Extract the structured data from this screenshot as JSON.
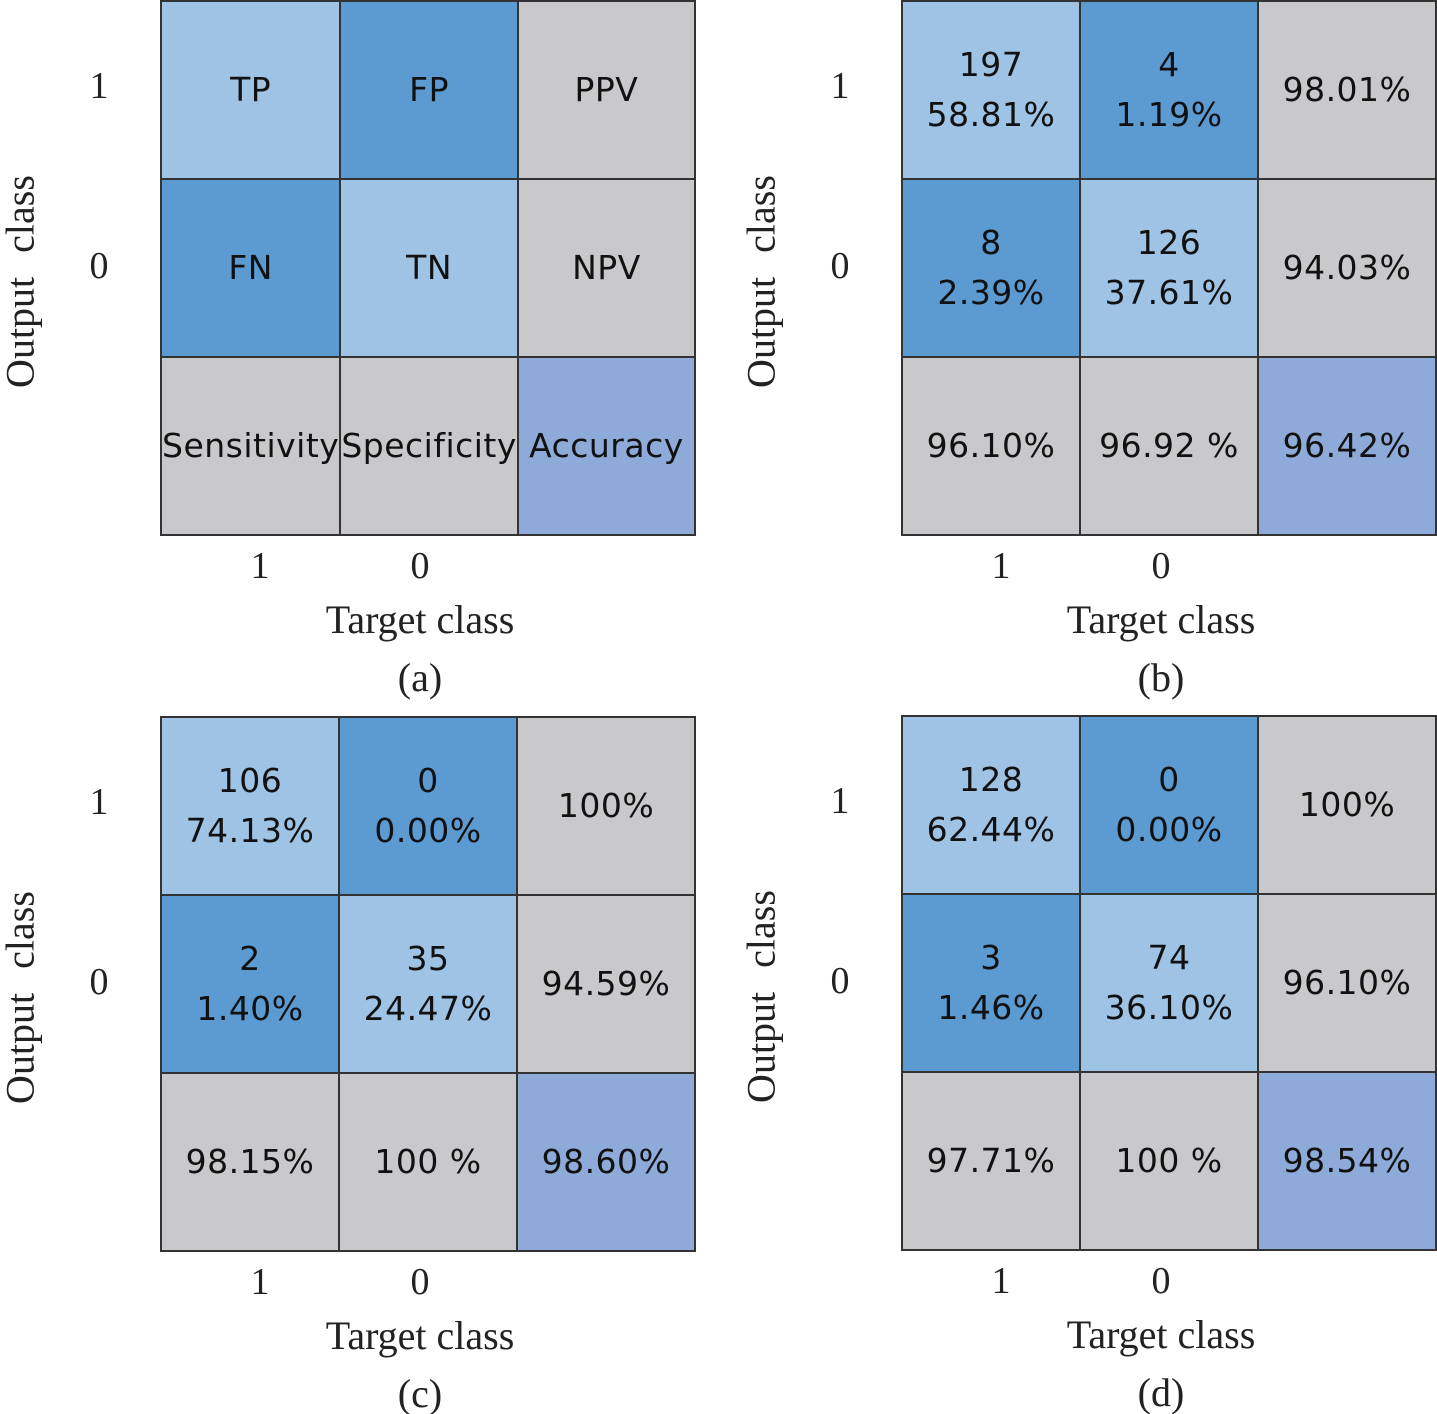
{
  "colors": {
    "correct": "#9fc3e5",
    "error": "#5b9bd2",
    "metric": "#c9c9cb",
    "accuracy": "#8eaad8"
  },
  "chart_data": [
    {
      "type": "heatmap",
      "panel": "(a)",
      "xlabel": "Target class",
      "ylabel": "Output class",
      "row_labels": [
        "1",
        "0"
      ],
      "col_labels": [
        "1",
        "0"
      ],
      "cells": [
        [
          [
            "TP"
          ],
          [
            "FP"
          ],
          [
            "PPV"
          ]
        ],
        [
          [
            "FN"
          ],
          [
            "TN"
          ],
          [
            "NPV"
          ]
        ],
        [
          [
            "Sensitivity"
          ],
          [
            "Specificity"
          ],
          [
            "Accuracy"
          ]
        ]
      ]
    },
    {
      "type": "heatmap",
      "panel": "(b)",
      "xlabel": "Target class",
      "ylabel": "Output class",
      "row_labels": [
        "1",
        "0"
      ],
      "col_labels": [
        "1",
        "0"
      ],
      "cells": [
        [
          [
            "197",
            "58.81%"
          ],
          [
            "4",
            "1.19%"
          ],
          [
            "98.01%"
          ]
        ],
        [
          [
            "8",
            "2.39%"
          ],
          [
            "126",
            "37.61%"
          ],
          [
            "94.03%"
          ]
        ],
        [
          [
            "96.10%"
          ],
          [
            "96.92 %"
          ],
          [
            "96.42%"
          ]
        ]
      ]
    },
    {
      "type": "heatmap",
      "panel": "(c)",
      "xlabel": "Target class",
      "ylabel": "Output class",
      "row_labels": [
        "1",
        "0"
      ],
      "col_labels": [
        "1",
        "0"
      ],
      "cells": [
        [
          [
            "106",
            "74.13%"
          ],
          [
            "0",
            "0.00%"
          ],
          [
            "100%"
          ]
        ],
        [
          [
            "2",
            "1.40%"
          ],
          [
            "35",
            "24.47%"
          ],
          [
            "94.59%"
          ]
        ],
        [
          [
            "98.15%"
          ],
          [
            "100 %"
          ],
          [
            "98.60%"
          ]
        ]
      ]
    },
    {
      "type": "heatmap",
      "panel": "(d)",
      "xlabel": "Target class",
      "ylabel": "Output class",
      "row_labels": [
        "1",
        "0"
      ],
      "col_labels": [
        "1",
        "0"
      ],
      "cells": [
        [
          [
            "128",
            "62.44%"
          ],
          [
            "0",
            "0.00%"
          ],
          [
            "100%"
          ]
        ],
        [
          [
            "3",
            "1.46%"
          ],
          [
            "74",
            "36.10%"
          ],
          [
            "96.10%"
          ]
        ],
        [
          [
            "97.71%"
          ],
          [
            "100 %"
          ],
          [
            "98.54%"
          ]
        ]
      ]
    }
  ]
}
